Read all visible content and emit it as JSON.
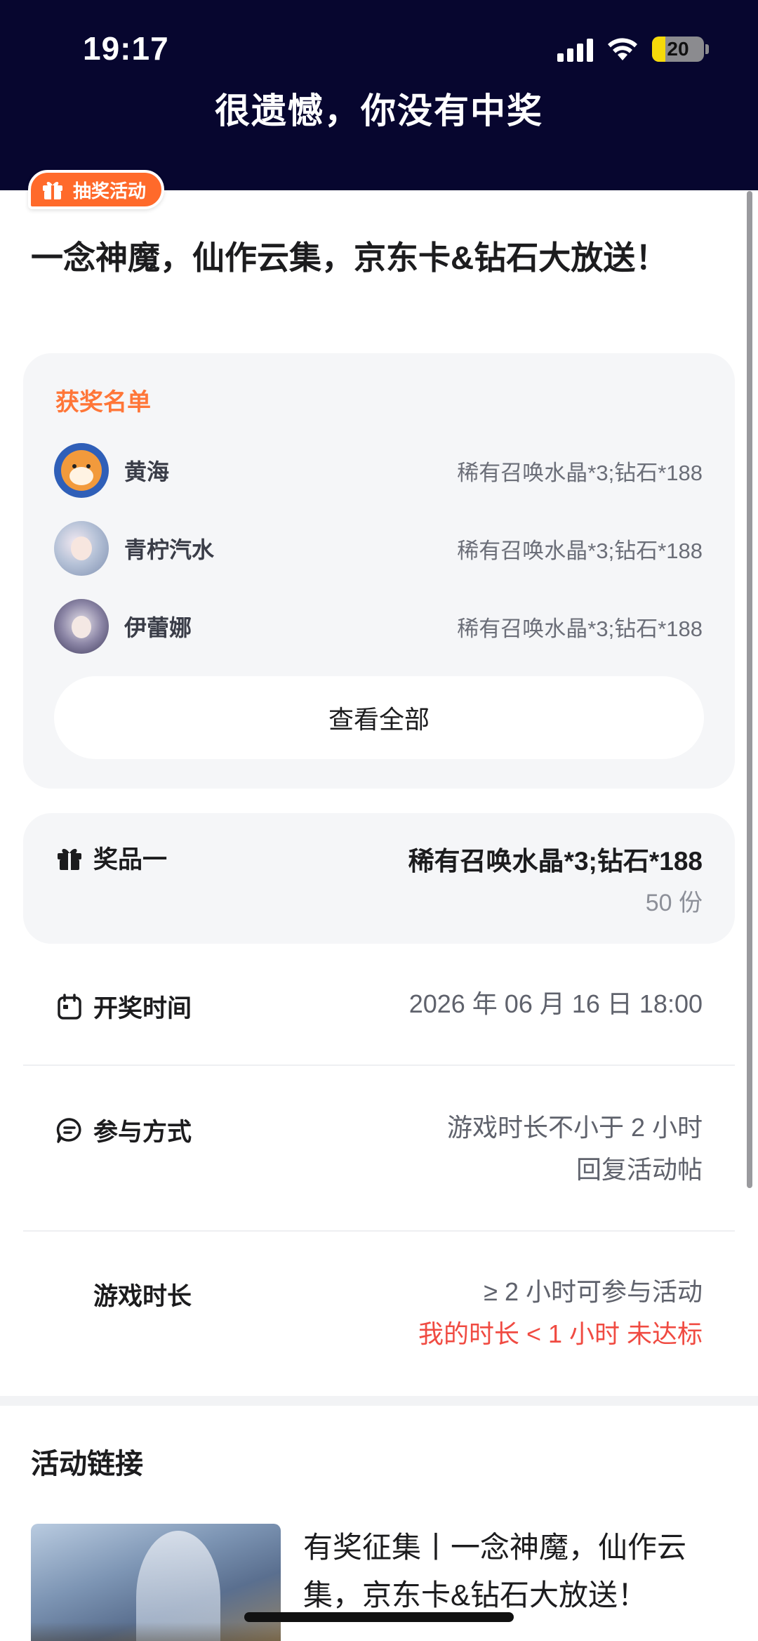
{
  "status_bar": {
    "time": "19:17",
    "battery": "20"
  },
  "header": {
    "title": "很遗憾，你没有中奖"
  },
  "badge": {
    "label": "抽奖活动",
    "icon": "gift-icon"
  },
  "post": {
    "title": "一念神魔，仙作云集，京东卡&钻石大放送！"
  },
  "winners": {
    "label": "获奖名单",
    "items": [
      {
        "name": "黄海",
        "prize": "稀有召唤水晶*3;钻石*188"
      },
      {
        "name": "青柠汽水",
        "prize": "稀有召唤水晶*3;钻石*188"
      },
      {
        "name": "伊蕾娜",
        "prize": "稀有召唤水晶*3;钻石*188"
      }
    ],
    "view_all": "查看全部"
  },
  "prize": {
    "label": "奖品一",
    "value": "稀有召唤水晶*3;钻石*188",
    "count": "50 份",
    "icon": "gift-icon"
  },
  "draw_time": {
    "label": "开奖时间",
    "value": "2026 年 06 月 16 日 18:00",
    "icon": "calendar-icon"
  },
  "participation": {
    "label": "参与方式",
    "line1": "游戏时长不小于 2 小时",
    "line2": "回复活动帖",
    "icon": "chat-icon"
  },
  "play_time": {
    "label": "游戏时长",
    "requirement": "≥ 2 小时可参与活动",
    "status": "我的时长 < 1 小时 未达标"
  },
  "activity_link": {
    "heading": "活动链接",
    "text": "有奖征集丨一念神魔，仙作云集，京东卡&钻石大放送！"
  },
  "colors": {
    "header_bg": "#07062f",
    "accent": "#ff6a2b",
    "warning": "#f04b42",
    "winners_label": "#ff7638"
  }
}
